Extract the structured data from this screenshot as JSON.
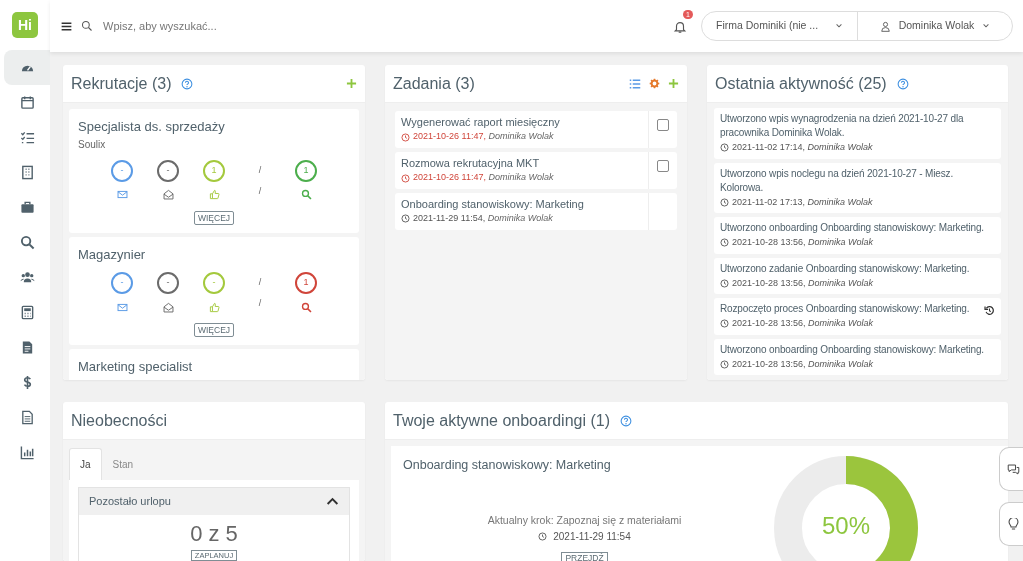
{
  "logo": {
    "text": "Hi"
  },
  "sidebar": {
    "items": [
      {
        "selected": true
      },
      {
        "selected": false
      },
      {
        "selected": false
      },
      {
        "selected": false
      },
      {
        "selected": false
      },
      {
        "selected": false
      },
      {
        "selected": false
      },
      {
        "selected": false
      },
      {
        "selected": false
      },
      {
        "selected": false
      },
      {
        "selected": false
      },
      {
        "selected": false
      }
    ]
  },
  "topbar": {
    "search": {
      "placeholder": "Wpisz, aby wyszukać..."
    },
    "notifications": {
      "count": "1"
    },
    "company_select": {
      "value": "Firma Dominiki (nie ..."
    },
    "user_menu": {
      "name": "Dominika Wolak"
    }
  },
  "recruitments": {
    "title": "Rekrutacje (3)",
    "items": [
      {
        "title": "Specjalista ds. sprzedaży",
        "company": "Soulix",
        "stats": [
          {
            "kind": "count",
            "value": "-",
            "color": "#5b9be6"
          },
          {
            "kind": "count",
            "value": "-",
            "color": "#6b6b6b"
          },
          {
            "kind": "count",
            "value": "1",
            "color": "#a4c93d"
          },
          {
            "kind": "separator",
            "value": "/",
            "value_below": "/"
          },
          {
            "kind": "count",
            "value": "1",
            "color": "#4cae4c"
          }
        ],
        "button": "WIĘCEJ"
      },
      {
        "title": "Magazynier",
        "stats": [
          {
            "kind": "count",
            "value": "-",
            "color": "#5b9be6"
          },
          {
            "kind": "count",
            "value": "-",
            "color": "#6b6b6b"
          },
          {
            "kind": "count",
            "value": "-",
            "color": "#a4c93d"
          },
          {
            "kind": "separator",
            "value": "/",
            "value_below": "/"
          },
          {
            "kind": "count",
            "value": "1",
            "color": "#d0453a"
          }
        ],
        "button": "WIĘCEJ"
      },
      {
        "title": "Marketing specialist"
      }
    ]
  },
  "tasks": {
    "title": "Zadania (3)",
    "items": [
      {
        "title": "Wygenerować raport miesięczny",
        "time": "2021-10-26 11:47,",
        "author": "Dominika Wolak",
        "overdue": true,
        "checkable": true,
        "checked": false
      },
      {
        "title": "Rozmowa rekrutacyjna MKT",
        "time": "2021-10-26 11:47,",
        "author": "Dominika Wolak",
        "overdue": true,
        "checkable": true,
        "checked": false
      },
      {
        "title": "Onboarding stanowiskowy: Marketing",
        "time": "2021-11-29 11:54,",
        "author": "Dominika Wolak",
        "overdue": false,
        "checkable": false
      }
    ]
  },
  "activity": {
    "title": "Ostatnia aktywność (25)",
    "items": [
      {
        "text": "Utworzono wpis wynagrodzenia na dzień 2021-10-27 dla pracownika Dominika Wolak.",
        "time": "2021-11-02 17:14,",
        "author": "Dominika Wolak",
        "revertible": false
      },
      {
        "text": "Utworzono wpis noclegu na dzień 2021-10-27 - Miesz. Kolorowa.",
        "time": "2021-11-02 17:13,",
        "author": "Dominika Wolak",
        "revertible": false
      },
      {
        "text": "Utworzono onboarding Onboarding stanowiskowy: Marketing.",
        "time": "2021-10-28 13:56,",
        "author": "Dominika Wolak",
        "revertible": false
      },
      {
        "text": "Utworzono zadanie Onboarding stanowiskowy: Marketing.",
        "time": "2021-10-28 13:56,",
        "author": "Dominika Wolak",
        "revertible": false
      },
      {
        "text": "Rozpoczęto proces Onboarding stanowiskowy: Marketing.",
        "time": "2021-10-28 13:56,",
        "author": "Dominika Wolak",
        "revertible": true
      },
      {
        "text": "Utworzono onboarding Onboarding stanowiskowy: Marketing.",
        "time": "2021-10-28 13:56,",
        "author": "Dominika Wolak",
        "revertible": false
      }
    ]
  },
  "absences": {
    "title": "Nieobecności",
    "tabs": [
      {
        "label": "Ja",
        "selected": true
      },
      {
        "label": "Stan",
        "selected": false
      }
    ],
    "panel": {
      "title": "Pozostało urlopu",
      "expanded": true,
      "value": "0 z 5",
      "button": "ZAPLANUJ"
    }
  },
  "onboardings": {
    "title": "Twoje aktywne onboardingi (1)",
    "items": [
      {
        "title": "Onboarding stanowiskowy: Marketing",
        "step": "Aktualny krok: Zapoznaj się z materiałami",
        "time": "2021-11-29 11:54",
        "button": "PRZEJDŹ",
        "level": 0.5,
        "progress_label": "50%"
      }
    ]
  }
}
